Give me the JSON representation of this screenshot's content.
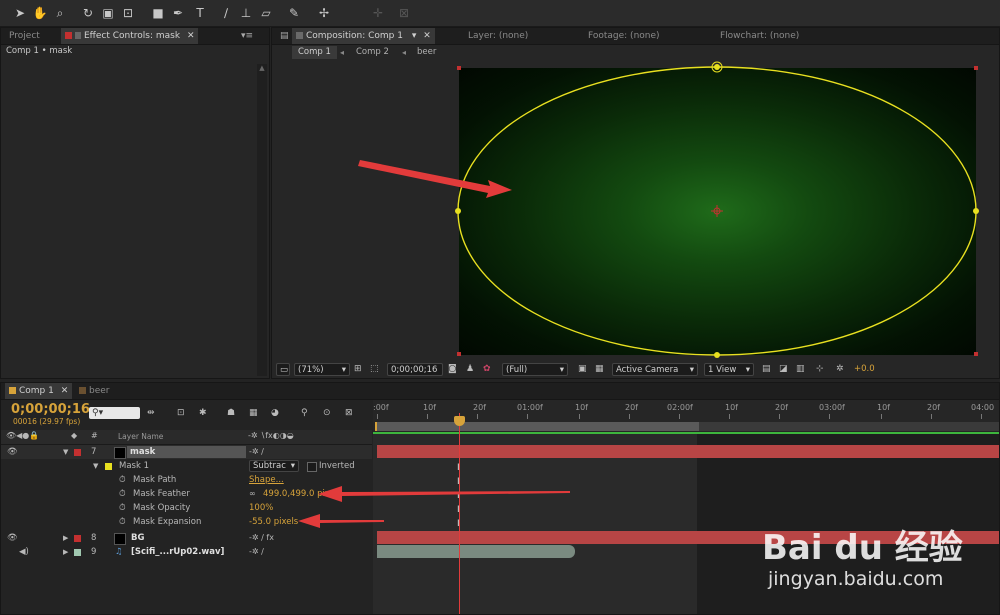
{
  "toolbar": {
    "tools": [
      "selection-tool",
      "hand-tool",
      "zoom-tool",
      "rotate-tool",
      "camera-tool",
      "pan-behind-tool",
      "rectangle-tool",
      "pen-tool",
      "text-tool",
      "brush-tool",
      "clone-stamp-tool",
      "eraser-tool",
      "roto-brush-tool",
      "puppet-tool"
    ]
  },
  "left_panel": {
    "tab_project": "Project",
    "tab_effect": "Effect Controls: mask",
    "subtitle": "Comp 1 • mask"
  },
  "comp_panel": {
    "tab_comp": "Composition: Comp 1",
    "tab_layer": "Layer: (none)",
    "tab_footage": "Footage: (none)",
    "tab_flowchart": "Flowchart: (none)",
    "crumbs": [
      "Comp 1",
      "Comp 2",
      "beer"
    ],
    "zoom": "(71%)",
    "timecode": "0;00;00;16",
    "resolution": "(Full)",
    "camera": "Active Camera",
    "view": "1 View",
    "exposure": "+0.0"
  },
  "timeline": {
    "tab_comp": "Comp 1",
    "tab_beer": "beer",
    "timecode": "0;00;00;16",
    "fps": "00016 (29.97 fps)",
    "search_placeholder": "",
    "col_hash": "#",
    "col_layername": "Layer Name",
    "ruler": [
      ":00f",
      "10f",
      "20f",
      "01:00f",
      "10f",
      "20f",
      "02:00f",
      "10f",
      "20f",
      "03:00f",
      "10f",
      "20f",
      "04:00"
    ],
    "layers": [
      {
        "num": "7",
        "name": "mask",
        "color": "#c33030"
      },
      {
        "num": "8",
        "name": "BG",
        "color": "#c33030"
      },
      {
        "num": "9",
        "name": "[Scifi_...rUp02.wav]",
        "color": "#a0c8b0"
      }
    ],
    "mask": {
      "name": "Mask 1",
      "mode": "Subtrac",
      "inverted": "Inverted",
      "props": [
        {
          "label": "Mask Path",
          "value": "Shape..."
        },
        {
          "label": "Mask Feather",
          "value": "499.0,499.0 pixels"
        },
        {
          "label": "Mask Opacity",
          "value": "100%"
        },
        {
          "label": "Mask Expansion",
          "value": "-55.0 pixels"
        }
      ]
    }
  },
  "watermark": {
    "brand": "Bai du 经验",
    "url": "jingyan.baidu.com"
  },
  "colors": {
    "accent_orange": "#d7a33a",
    "mask_yellow": "#e8e020",
    "arrow_red": "#e23b3b",
    "layer_bar": "#b84545"
  }
}
